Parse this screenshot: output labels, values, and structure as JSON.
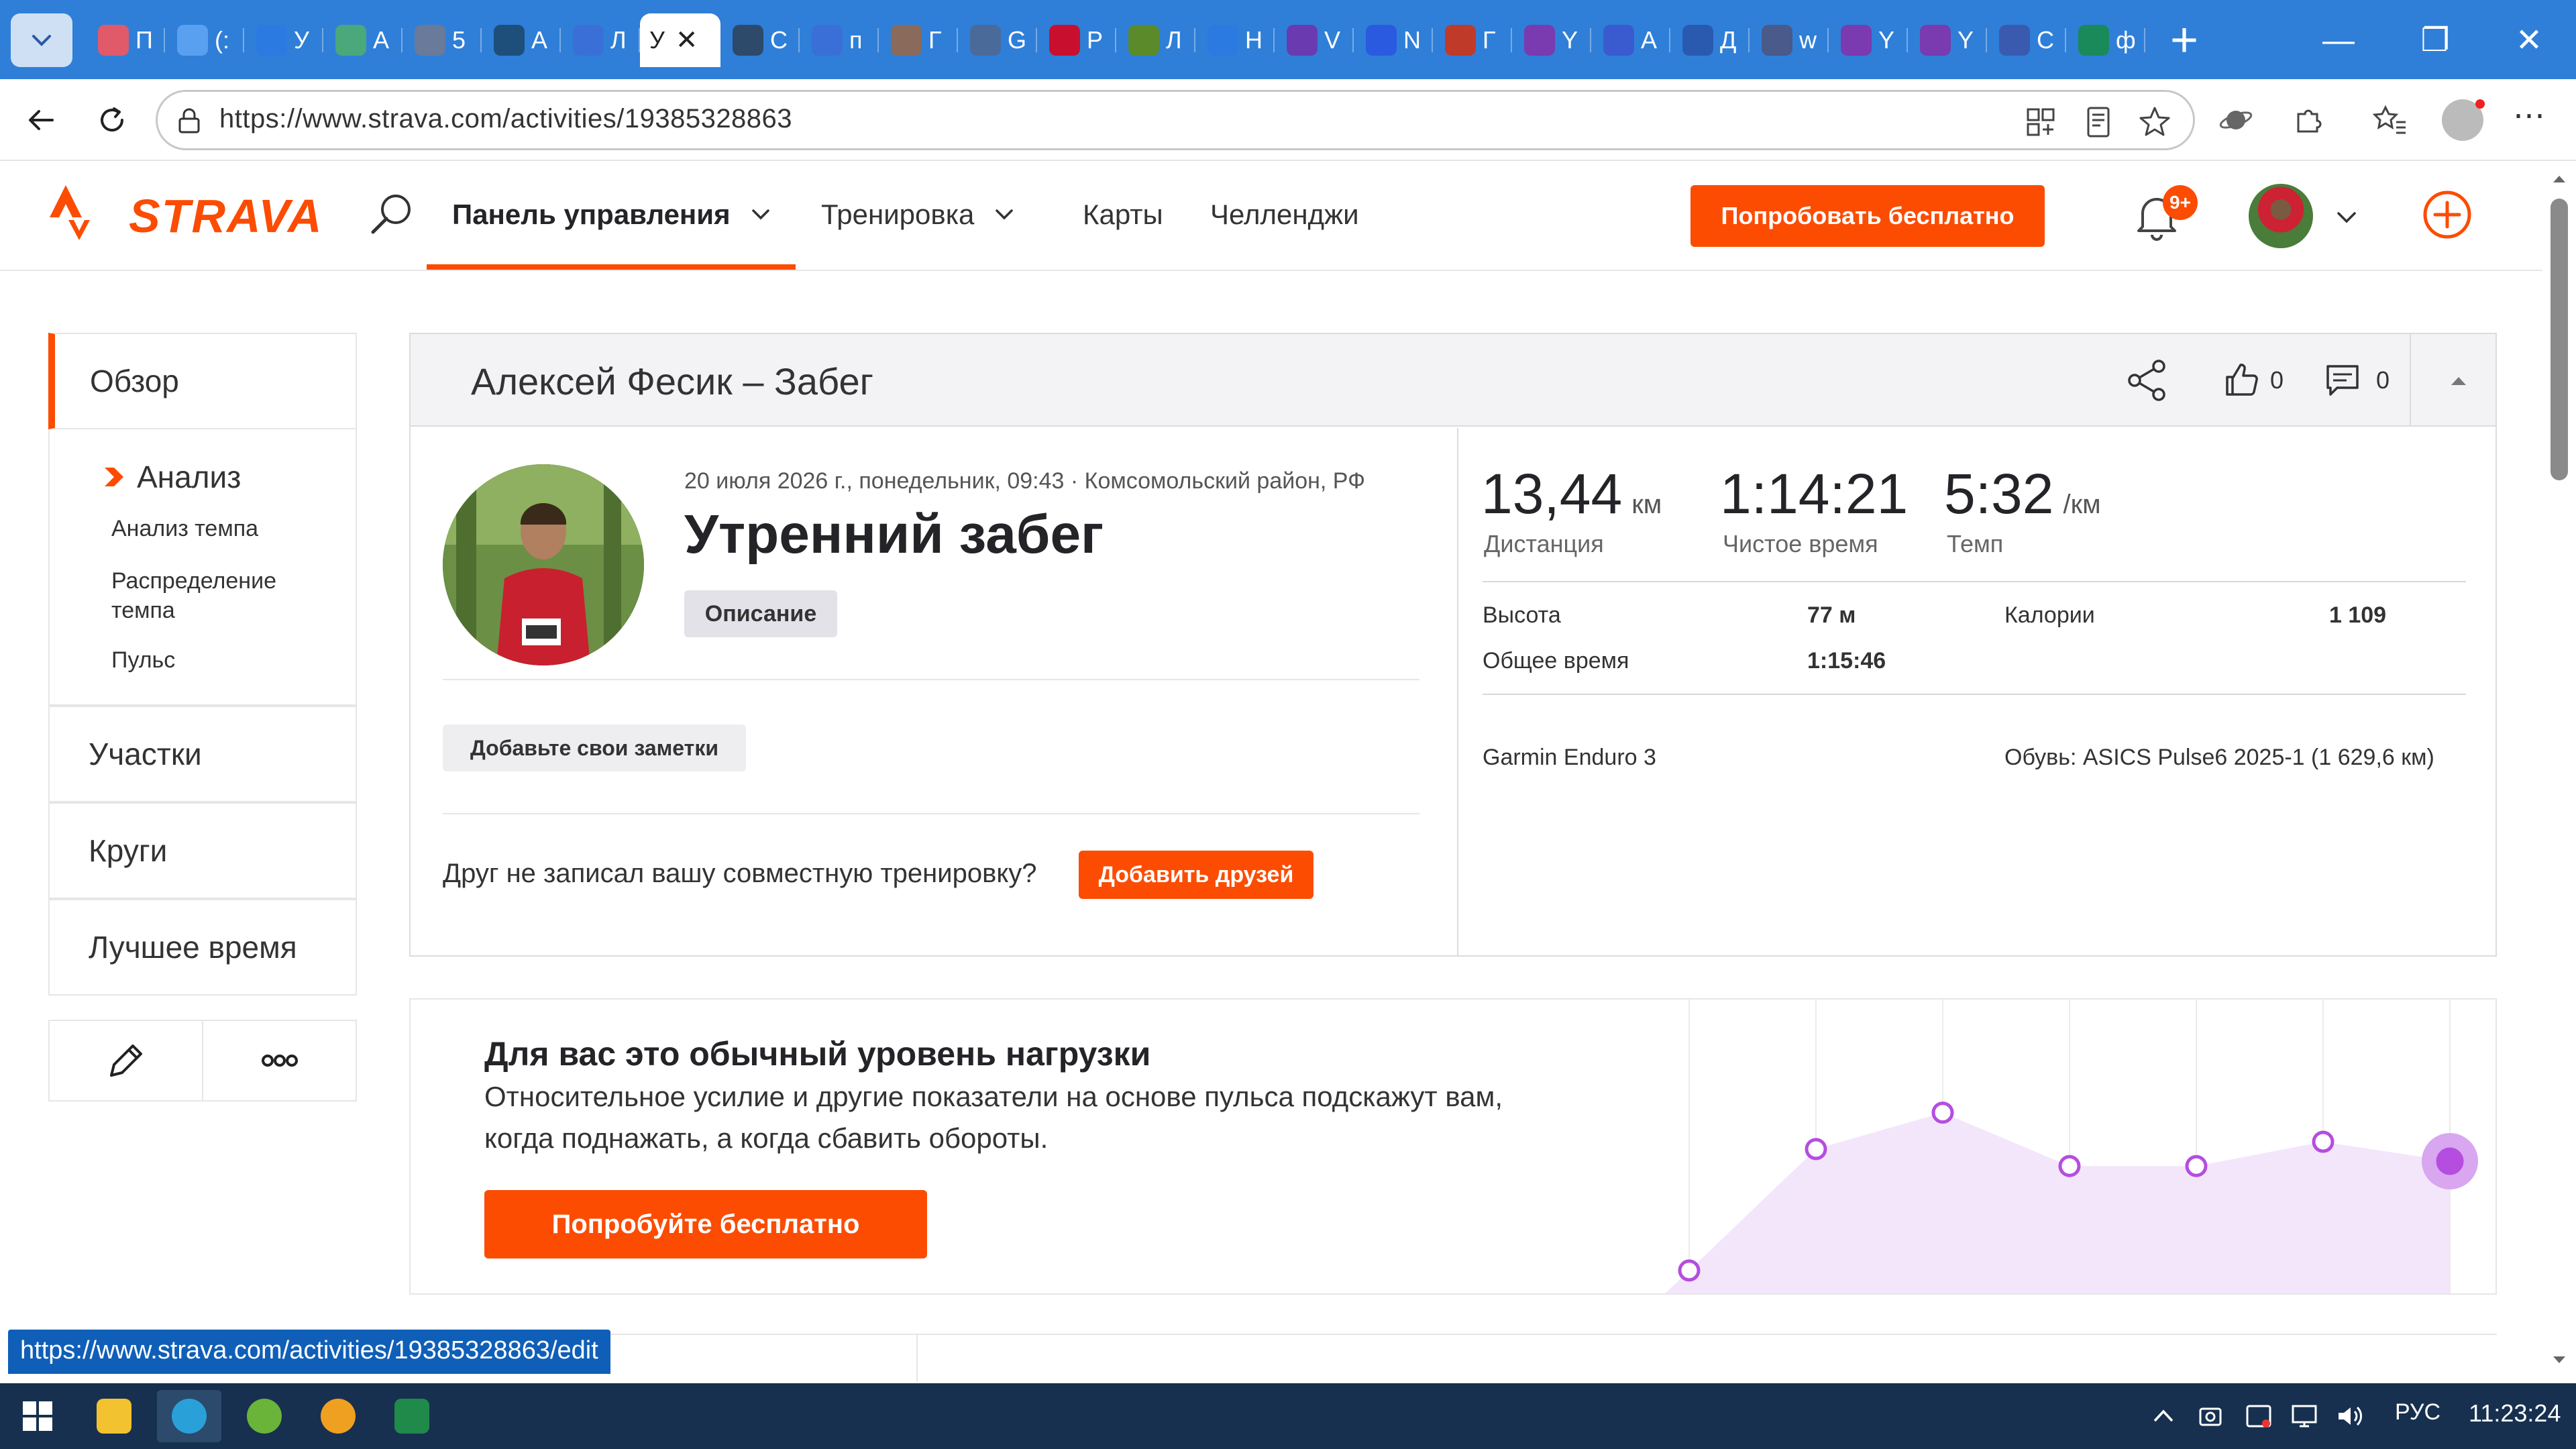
{
  "browser": {
    "tabs": [
      {
        "label": "П",
        "color": "#e05a6a"
      },
      {
        "label": "(:",
        "color": "#5aa0f0"
      },
      {
        "label": "У",
        "color": "#2a7ae2"
      },
      {
        "label": "А",
        "color": "#4aa87a"
      },
      {
        "label": "5",
        "color": "#6a7a9a"
      },
      {
        "label": "А",
        "color": "#1d4f7a"
      },
      {
        "label": "Л",
        "color": "#3a6fd8"
      },
      {
        "label": "У",
        "color": "#ffffff",
        "active": true
      },
      {
        "label": "С",
        "color": "#2d4a6a"
      },
      {
        "label": "п",
        "color": "#3a6fd8"
      },
      {
        "label": "Г",
        "color": "#8a6a5a"
      },
      {
        "label": "G",
        "color": "#4a6a9a"
      },
      {
        "label": "Р",
        "color": "#c8102e"
      },
      {
        "label": "Л",
        "color": "#5a8a2a"
      },
      {
        "label": "Н",
        "color": "#2a7ae2"
      },
      {
        "label": "V",
        "color": "#6a3ab0"
      },
      {
        "label": "N",
        "color": "#2a5ae0"
      },
      {
        "label": "Г",
        "color": "#c03a2a"
      },
      {
        "label": "Y",
        "color": "#7a3ab0"
      },
      {
        "label": "А",
        "color": "#3a5ad0"
      },
      {
        "label": "Д",
        "color": "#2a5ab0"
      },
      {
        "label": "w",
        "color": "#4a5a8a"
      },
      {
        "label": "Y",
        "color": "#7a3ab0"
      },
      {
        "label": "Y",
        "color": "#7a3ab0"
      },
      {
        "label": "С",
        "color": "#3a5ab0"
      },
      {
        "label": "ф",
        "color": "#1a8a5a"
      }
    ],
    "active_tab_close": "✕",
    "url": "https://www.strava.com/activities/19385328863",
    "status_link": "https://www.strava.com/activities/19385328863/edit"
  },
  "header": {
    "logo": "STRAVA",
    "nav": [
      {
        "label": "Панель управления",
        "active": true,
        "dropdown": true
      },
      {
        "label": "Тренировка",
        "active": false,
        "dropdown": true
      },
      {
        "label": "Карты",
        "active": false,
        "dropdown": false
      },
      {
        "label": "Челленджи",
        "active": false,
        "dropdown": false
      }
    ],
    "try_button": "Попробовать бесплатно",
    "notifications_badge": "9+",
    "accent_color": "#fc4c02"
  },
  "sidebar": {
    "overview": "Обзор",
    "analysis": "Анализ",
    "analysis_items": [
      "Анализ темпа",
      "Распределение темпа",
      "Пульс"
    ],
    "segments": "Участки",
    "laps": "Круги",
    "best_efforts": "Лучшее время"
  },
  "activity": {
    "header_title": "Алексей Фесик – Забег",
    "kudos_count": "0",
    "comments_count": "0",
    "meta": "20 июля 2026 г., понедельник, 09:43 · Комсомольский район, РФ",
    "name": "Утренний забег",
    "description_button": "Описание",
    "notes_button": "Добавьте свои заметки",
    "friend_question": "Друг не записал вашу совместную тренировку?",
    "add_friends_button": "Добавить друзей",
    "stats": {
      "distance": {
        "value": "13,44",
        "unit": "км",
        "label": "Дистанция"
      },
      "moving_time": {
        "value": "1:14:21",
        "label": "Чистое время"
      },
      "pace": {
        "value": "5:32",
        "unit": "/км",
        "label": "Темп"
      }
    },
    "details": {
      "elevation_label": "Высота",
      "elevation_value": "77 м",
      "calories_label": "Калории",
      "calories_value": "1 109",
      "elapsed_label": "Общее время",
      "elapsed_value": "1:15:46",
      "device": "Garmin Enduro 3",
      "shoes": "Обувь: ASICS Pulse6 2025-1 (1 629,6 км)"
    }
  },
  "effort": {
    "title": "Для вас это обычный уровень нагрузки",
    "text": "Относительное усилие и другие показатели на основе пульса подскажут вам, когда поднажать, а когда сбавить обороты.",
    "button": "Попробуйте бесплатно",
    "chart_color": "#b54de0",
    "chart_levels": [
      0.05,
      0.55,
      0.7,
      0.48,
      0.48,
      0.58,
      0.5
    ]
  },
  "taskbar": {
    "language": "РУС",
    "clock": "11:23:24"
  }
}
